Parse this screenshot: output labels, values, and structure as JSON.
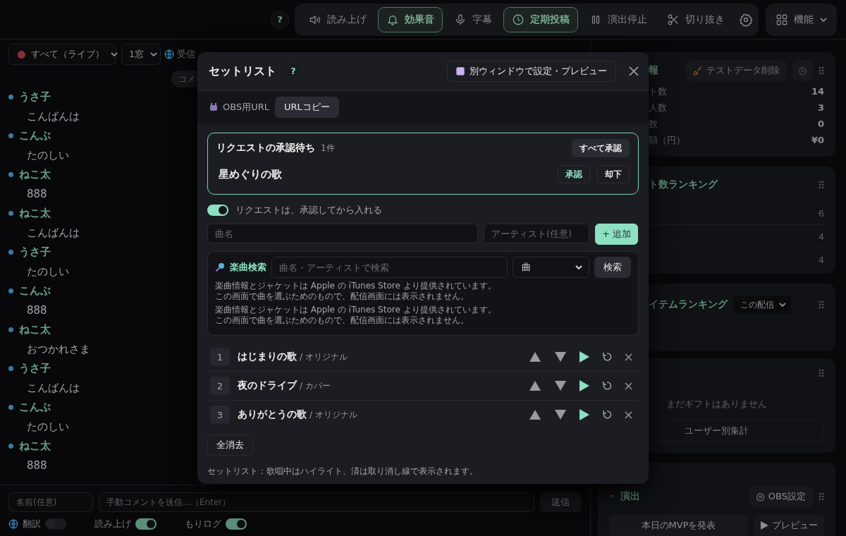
{
  "header": {
    "help": "?",
    "toolbar": [
      {
        "label": "読み上げ",
        "selected": false
      },
      {
        "label": "効果音",
        "selected": true
      },
      {
        "label": "字幕",
        "selected": false
      },
      {
        "label": "定期投稿",
        "selected": true
      },
      {
        "label": "演出停止",
        "selected": false
      },
      {
        "label": "切り抜き",
        "selected": false
      }
    ],
    "features": "機能"
  },
  "chat": {
    "source": "すべて（ライブ）",
    "windows": "1窓",
    "translate": "受信",
    "chip": "コメ",
    "messages": [
      {
        "name": "うさ子",
        "text": "こんばんは"
      },
      {
        "name": "こんぶ",
        "text": "たのしい"
      },
      {
        "name": "ねこ太",
        "text": "888"
      },
      {
        "name": "ねこ太",
        "text": "こんばんは"
      },
      {
        "name": "うさ子",
        "text": "たのしい"
      },
      {
        "name": "こんぶ",
        "text": "888"
      },
      {
        "name": "ねこ太",
        "text": "おつかれさま"
      },
      {
        "name": "うさ子",
        "text": "こんばんは"
      },
      {
        "name": "こんぶ",
        "text": "たのしい"
      },
      {
        "name": "ねこ太",
        "text": "888"
      }
    ],
    "name_placeholder": "名前(任意)",
    "comment_placeholder": "手動コメントを送信…（Enter）",
    "send": "送信",
    "toggles": [
      {
        "label": "翻訳",
        "on": false
      },
      {
        "label": "読み上げ",
        "on": true
      },
      {
        "label": "もりログ",
        "on": true
      }
    ]
  },
  "side": {
    "info": {
      "title": "報",
      "clear_button": "テストデータ削除",
      "stats": [
        {
          "label": "ト数",
          "value": "14"
        },
        {
          "label": "人数",
          "value": "3"
        },
        {
          "label": "数",
          "value": "0"
        },
        {
          "label": "額（円）",
          "value": "¥0"
        }
      ]
    },
    "comment_ranking": {
      "title": "ト数ランキング",
      "values": [
        "6",
        "4",
        "4"
      ]
    },
    "item_ranking": {
      "title": "イテムランキング",
      "scope": "この配信"
    },
    "gifts": {
      "empty": "まだギフトはありません",
      "by_user": "ユーザー別集計"
    },
    "effects": {
      "title": "演出",
      "obs_settings": "OBS設定",
      "mvp": "本日のMVPを発表",
      "preview": "プレビュー"
    }
  },
  "setlist": {
    "title": "セットリスト",
    "help": "?",
    "popout": "別ウィンドウで設定・プレビュー",
    "obs_label": "OBS用URL",
    "copy": "URLコピー",
    "pending": {
      "title": "リクエストの承認待ち",
      "count": "1件",
      "approve_all": "すべて承認",
      "requests": [
        {
          "title": "星めぐりの歌",
          "approve": "承認",
          "reject": "却下"
        }
      ]
    },
    "approval_toggle": {
      "label": "リクエストは、承認してから入れる",
      "on": true
    },
    "song_placeholder": "曲名",
    "artist_placeholder": "アーティスト(任意)",
    "add": "+ 追加",
    "search": {
      "label": "楽曲検索",
      "placeholder": "曲名・アーティストで検索",
      "type": "曲",
      "button": "検索",
      "notes": [
        {
          "lines": [
            "楽曲情報とジャケットは Apple の iTunes Store より提供されています。",
            "この画面で曲を選ぶためのもので、配信画面には表示されません。"
          ]
        },
        {
          "lines": [
            "楽曲情報とジャケットは Apple の iTunes Store より提供されています。",
            "この画面で曲を選ぶためのもので、配信画面には表示されません。"
          ]
        }
      ]
    },
    "songs": [
      {
        "number": "1",
        "title": "はじまりの歌",
        "note": "/ オリジナル"
      },
      {
        "number": "2",
        "title": "夜のドライブ",
        "note": "/ カバー"
      },
      {
        "number": "3",
        "title": "ありがとうの歌",
        "note": "/ オリジナル"
      }
    ],
    "clear": "全消去",
    "footer": "セットリスト：歌唱中はハイライト、済は取り消し線で表示されます。"
  }
}
